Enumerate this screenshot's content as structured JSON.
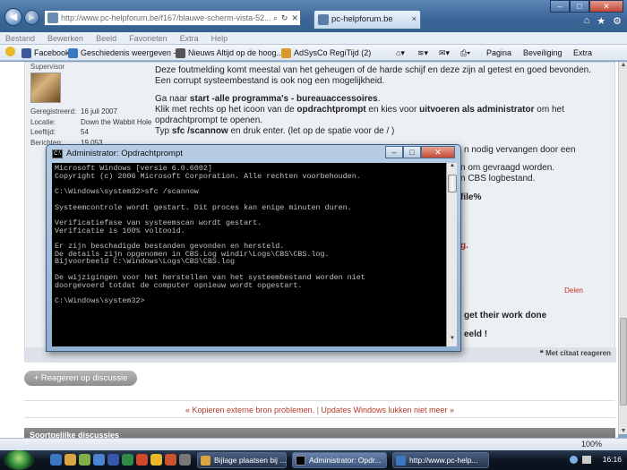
{
  "browser": {
    "url": "http://www.pc-helpforum.be/f167/blauwe-scherm-vista-52...",
    "tab_title": "pc-helpforum.be",
    "menu": [
      "Bestand",
      "Bewerken",
      "Beeld",
      "Favorieten",
      "Extra",
      "Help"
    ],
    "favorites": [
      "Facebook",
      "Geschiedenis weergeven -...",
      "Nieuws  Altijd op de hoog...",
      "AdSysCo RegiTijd (2)"
    ],
    "commands": {
      "page": "Pagina",
      "security": "Beveiliging",
      "extra": "Extra"
    },
    "zoom": "100%"
  },
  "profile": {
    "role": "Supervisor",
    "stats": [
      {
        "k": "Geregistreerd:",
        "v": "16 juli 2007"
      },
      {
        "k": "Locatie:",
        "v": "Down the Wabbit Hole"
      },
      {
        "k": "Leeftijd:",
        "v": "54"
      },
      {
        "k": "Berichten:",
        "v": "19.053"
      }
    ]
  },
  "post": {
    "line1": "Deze foutmelding komt meestal van het geheugen of de harde schijf en deze zijn al getest en goed bevonden.",
    "line2": "Een corrupt systeembestand is ook nog een mogelijkheid.",
    "goto_prefix": "Ga naar ",
    "goto_bold": "start -alle programma's - bureauaccessoires",
    "goto_end": ".",
    "klik_prefix": "Klik met rechts op het icoon van de ",
    "klik_bold1": "opdrachtprompt",
    "klik_mid": " en kies voor ",
    "klik_bold2": "uitvoeren als administrator",
    "klik_end": " om het opdrachtprompt te openen.",
    "typ_prefix": "Typ ",
    "typ_bold": "sfc /scannow",
    "typ_end": " en druk enter. (let op de spatie voor de / )",
    "frag1": "n nodig vervangen door een",
    "frag2": "n om gevraagd worden.",
    "frag3": "n CBS logbestand.",
    "frag4": "file%",
    "frag5": "g.",
    "frag6": "get their work done",
    "frag7": "eeld !",
    "delen": "Delen",
    "quote": "Met citaat reageren"
  },
  "reply_button": "+ Reageren op discussie",
  "thread_nav": {
    "prev": "« Kopieren externe bron problemen.",
    "sep": " | ",
    "next": "Updates Windows lukken niet meer »"
  },
  "similar": "Soortgelijke discussies",
  "cmd": {
    "title": "Administrator: Opdrachtprompt",
    "output": "Microsoft Windows [versie 6.0.6002]\nCopyright (c) 2006 Microsoft Corporation. Alle rechten voorbehouden.\n\nC:\\Windows\\system32>sfc /scannow\n\nSysteemcontrole wordt gestart. Dit proces kan enige minuten duren.\n\nVerificatiefase van systeemscan wordt gestart.\nVerificatie is 100% voltooid.\n\nEr zijn beschadigde bestanden gevonden en hersteld.\nDe details zijn opgenomen in CBS.Log windir\\Logs\\CBS\\CBS.log.\nBijvoorbeeld C:\\Windows\\Logs\\CBS\\CBS.log\n\nDe wijzigingen voor het herstellen van het systeembestand worden niet\ndoorgevoerd totdat de computer opnieuw wordt opgestart.\n\nC:\\Windows\\system32>"
  },
  "taskbar": {
    "tasks": [
      "Bijlage plaatsen bij ...",
      "Administrator: Opdr...",
      "http://www.pc-help..."
    ],
    "clock": "16:16"
  }
}
